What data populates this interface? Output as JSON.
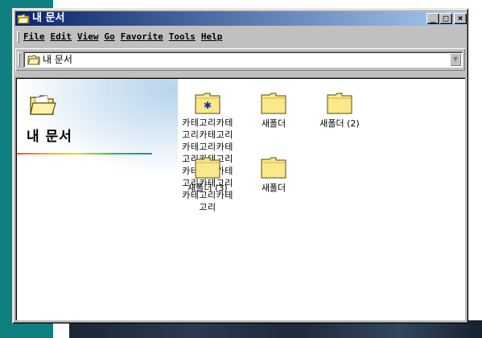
{
  "window": {
    "title": "내 문서",
    "controls": {
      "minimize": "_",
      "maximize": "□",
      "close": "×"
    }
  },
  "menu": [
    {
      "label": "File"
    },
    {
      "label": "Edit"
    },
    {
      "label": "View"
    },
    {
      "label": "Go"
    },
    {
      "label": "Favorite"
    },
    {
      "label": "Tools"
    },
    {
      "label": "Help"
    }
  ],
  "address": {
    "value": "내 문서"
  },
  "side_panel": {
    "title": "내 문서"
  },
  "items": [
    {
      "label": "카테고리카테고리카테고리카테고리카테고리카테고리카테고리카테고리카테고리카테고리카테고리",
      "icon": "special-folder-icon"
    },
    {
      "label": "새폴더",
      "icon": "folder-icon"
    },
    {
      "label": "새폴더 (2)",
      "icon": "folder-icon"
    },
    {
      "label": "새폴더 (3)",
      "icon": "folder-icon"
    },
    {
      "label": "새폴더",
      "icon": "folder-icon"
    }
  ],
  "colors": {
    "titlebar_start": "#0a246a",
    "titlebar_end": "#a6caf0",
    "desktop": "#0f7f7f",
    "folder": "#fbe88a"
  }
}
